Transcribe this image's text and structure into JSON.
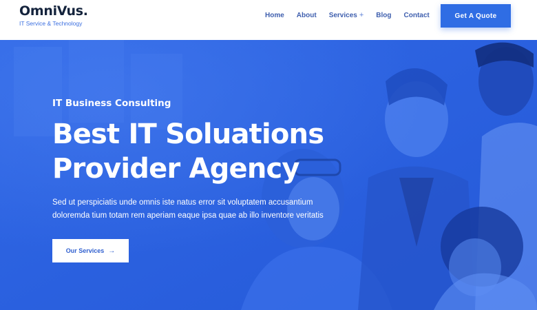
{
  "logo": {
    "name": "OmniVus.",
    "tagline": "IT Service & Technology"
  },
  "nav": {
    "items": [
      {
        "label": "Home"
      },
      {
        "label": "About"
      },
      {
        "label": "Services",
        "suffix": "+"
      },
      {
        "label": "Blog"
      },
      {
        "label": "Contact"
      }
    ]
  },
  "header": {
    "cta_label": "Get A Quote"
  },
  "hero": {
    "subtitle": "IT Business Consulting",
    "title_line1": "Best IT Soluations",
    "title_line2": "Provider Agency",
    "desc_line1": "Sed ut perspiciatis unde omnis iste natus error sit voluptatem accusantium",
    "desc_line2": "doloremda tium totam rem aperiam eaque ipsa quae ab illo inventore veritatis",
    "button_label": "Our Services",
    "button_arrow": "→"
  },
  "colors": {
    "brand": "#2f6de4",
    "overlay": "#2a63e4",
    "logo_text": "#14233c",
    "nav_text": "#3f5fae"
  }
}
